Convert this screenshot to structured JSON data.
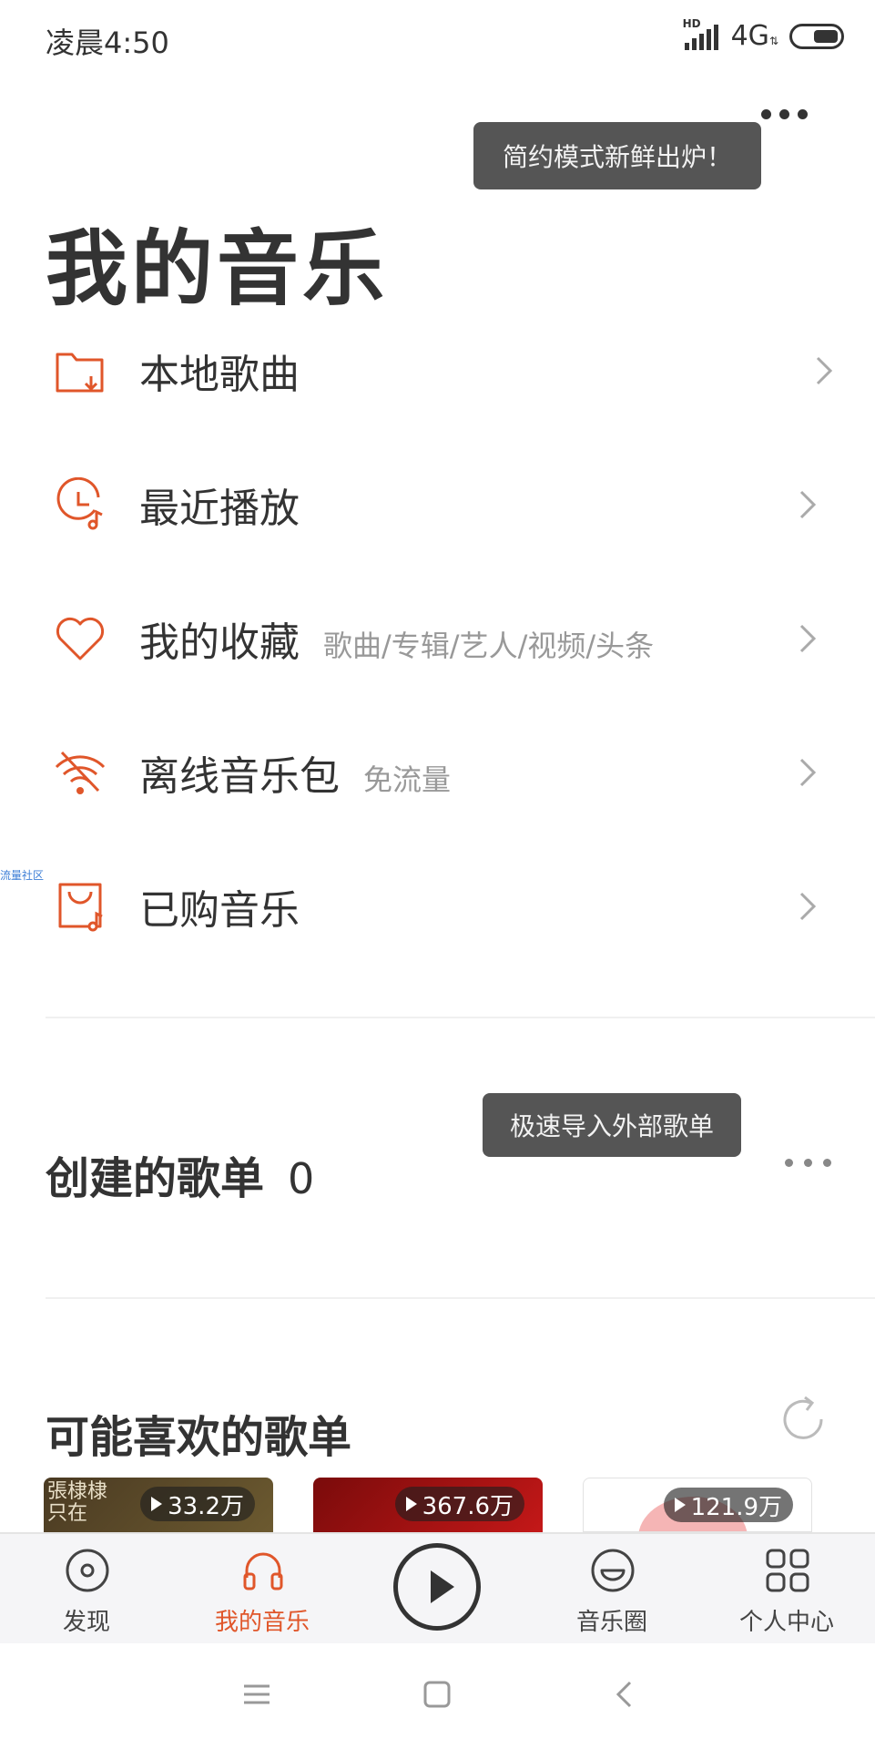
{
  "status_bar": {
    "time": "凌晨4:50",
    "network": "4G",
    "hd": "HD"
  },
  "header": {
    "title": "我的音乐",
    "more_icon": "more-dots-icon",
    "tooltip": "简约模式新鲜出炉！"
  },
  "menu": [
    {
      "icon": "folder-download-icon",
      "label": "本地歌曲",
      "sub": ""
    },
    {
      "icon": "clock-music-icon",
      "label": "最近播放",
      "sub": ""
    },
    {
      "icon": "heart-icon",
      "label": "我的收藏",
      "sub": "歌曲/专辑/艺人/视频/头条"
    },
    {
      "icon": "wifi-offline-icon",
      "label": "离线音乐包",
      "sub": "免流量"
    },
    {
      "icon": "bag-music-icon",
      "label": "已购音乐",
      "sub": ""
    }
  ],
  "side_label": "流量社区",
  "created": {
    "title": "创建的歌单",
    "count": "0",
    "tooltip": "极速导入外部歌单"
  },
  "recommended": {
    "title": "可能喜欢的歌单",
    "cards": [
      {
        "cover_text": "張棣棣\n只在",
        "plays": "33.2万"
      },
      {
        "cover_text": "",
        "plays": "367.6万"
      },
      {
        "cover_text": "",
        "plays": "121.9万"
      }
    ]
  },
  "colors": {
    "accent": "#e0562a",
    "text": "#333333",
    "muted": "#999999",
    "tabbar_bg": "#f5f5f7"
  },
  "tabs": [
    {
      "label": "发现",
      "icon": "disc-icon",
      "active": false
    },
    {
      "label": "我的音乐",
      "icon": "headphones-icon",
      "active": true
    },
    {
      "label": "",
      "icon": "play-icon",
      "active": false
    },
    {
      "label": "音乐圈",
      "icon": "smile-face-icon",
      "active": false
    },
    {
      "label": "个人中心",
      "icon": "grid-icon",
      "active": false
    }
  ],
  "nav": {
    "menu_icon": "menu-icon",
    "home_icon": "home-square-icon",
    "back_icon": "back-icon"
  }
}
